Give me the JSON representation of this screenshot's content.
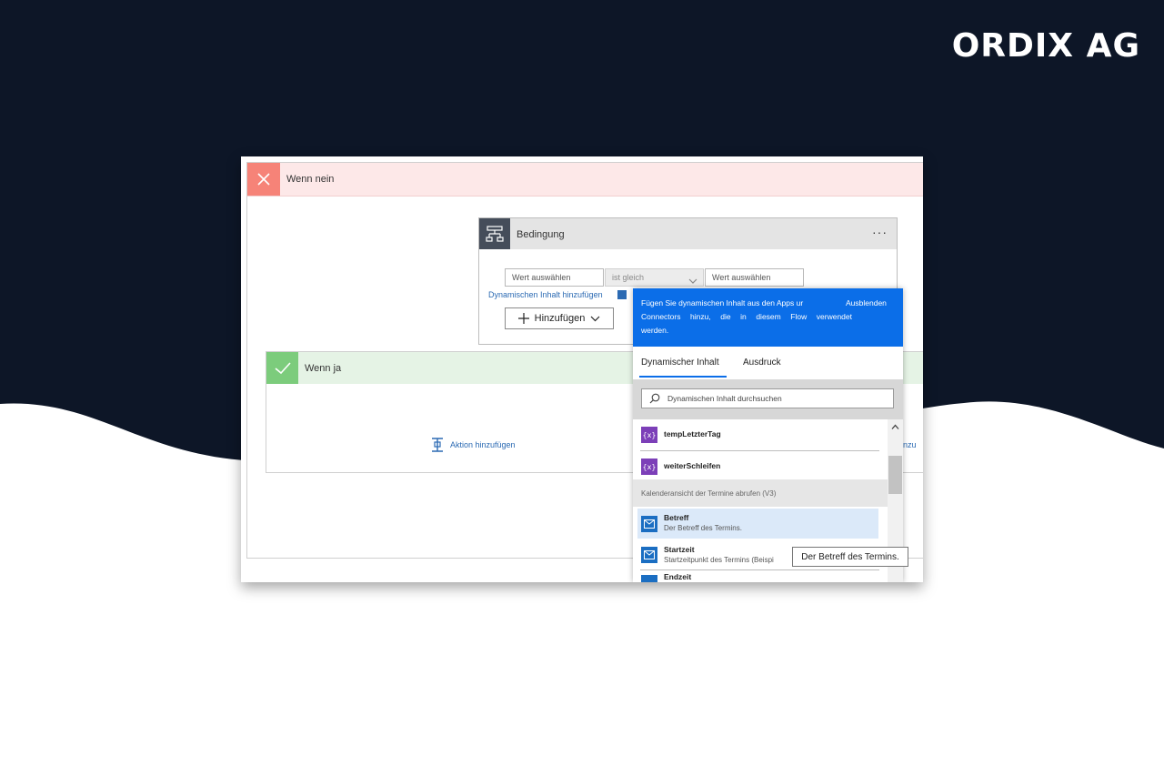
{
  "brand": {
    "name": "ORDIX AG"
  },
  "colors": {
    "dark_navy": "#0d1627",
    "popup_blue": "#0b6ee8",
    "no_red": "#f68378",
    "yes_green": "#7ccc7c",
    "variable_purple": "#7c3fb8",
    "outlook_blue": "#1b6ec2"
  },
  "no_branch": {
    "title": "Wenn nein",
    "icon": "close-icon"
  },
  "condition": {
    "title": "Bedingung",
    "menu": "···",
    "left_value_placeholder": "Wert auswählen",
    "operator": "ist gleich",
    "right_value_placeholder": "Wert auswählen",
    "dynamic_link": "Dynamischen Inhalt hinzufügen",
    "add_button": "Hinzufügen"
  },
  "yes_branch": {
    "title": "Wenn ja",
    "add_action": "Aktion hinzufügen",
    "truncated_right": "inzu"
  },
  "dynamic_popup": {
    "banner_line1": "Fügen Sie dynamischen Inhalt aus den Apps ur",
    "hide_label": "Ausblenden",
    "banner_line2": "Connectors hinzu, die in diesem Flow verwendet",
    "banner_line3": "werden.",
    "tabs": [
      "Dynamischer Inhalt",
      "Ausdruck"
    ],
    "search_placeholder": "Dynamischen Inhalt durchsuchen",
    "variables": [
      {
        "icon": "{x}",
        "title": "tempLetzterTag"
      },
      {
        "icon": "{x}",
        "title": "weiterSchleifen"
      }
    ],
    "section_title": "Kalenderansicht der Termine abrufen (V3)",
    "calendar_items": [
      {
        "title": "Betreff",
        "desc": "Der Betreff des Termins."
      },
      {
        "title": "Startzeit",
        "desc": "Startzeitpunkt des Termins (Beispi"
      },
      {
        "title": "Endzeit",
        "desc": ""
      }
    ]
  },
  "tooltip": {
    "text": "Der Betreff des Termins."
  }
}
